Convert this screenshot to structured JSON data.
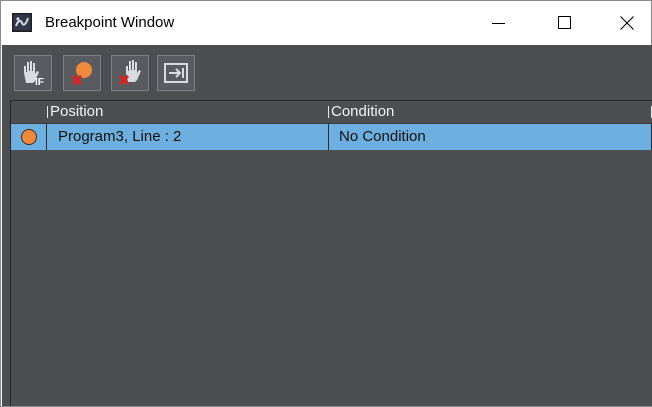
{
  "window": {
    "title": "Breakpoint Window",
    "icon": "debug-window-icon"
  },
  "title_buttons": [
    {
      "name": "minimize-icon",
      "glyph": "—"
    },
    {
      "name": "maximize-icon",
      "glyph": "☐"
    },
    {
      "name": "close-icon",
      "glyph": "✕"
    }
  ],
  "toolbar": {
    "buttons": [
      {
        "name": "conditional-breakpoint-icon",
        "label": "IF"
      },
      {
        "name": "delete-breakpoint-icon"
      },
      {
        "name": "delete-all-breakpoints-icon"
      },
      {
        "name": "go-to-breakpoint-icon"
      }
    ]
  },
  "table": {
    "columns": [
      "Position",
      "Condition"
    ],
    "rows": [
      {
        "position": "Program3, Line : 2",
        "condition": "No Condition",
        "status": "enabled"
      }
    ]
  },
  "colors": {
    "panel_bg": "#4d4e52",
    "selected_row": "#6db0df",
    "breakpoint": "#ef8a3c"
  }
}
